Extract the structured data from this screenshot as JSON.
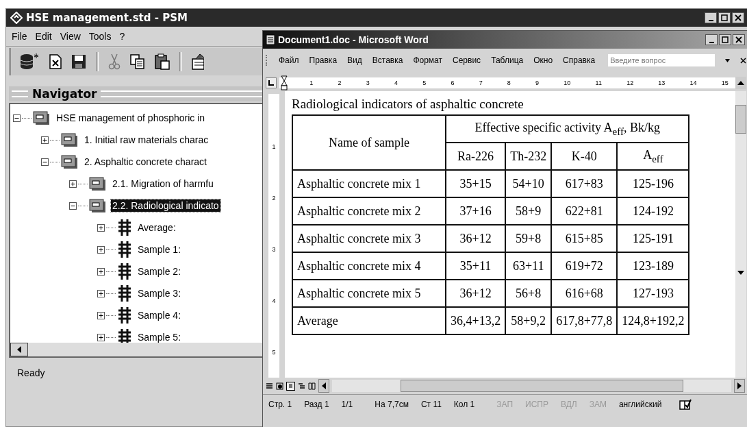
{
  "psm": {
    "title": "HSE management.std - PSM",
    "menu": [
      "File",
      "Edit",
      "View",
      "Tools",
      "?"
    ],
    "toolbar": [
      {
        "kind": "database"
      },
      {
        "kind": "close"
      },
      {
        "kind": "save"
      },
      {
        "kind": "cut"
      },
      {
        "kind": "copy"
      },
      {
        "kind": "paste"
      },
      {
        "kind": "properties"
      }
    ],
    "navigator": {
      "title": "Navigator",
      "tree": [
        {
          "label": "HSE management of phosphoric in",
          "kind": "folder",
          "expanded": true,
          "selected": false,
          "children": [
            {
              "label": "1. Initial raw materials charac",
              "kind": "folder",
              "expanded": false,
              "selected": false
            },
            {
              "label": "2. Asphaltic concrete charact",
              "kind": "folder",
              "expanded": true,
              "selected": false,
              "children": [
                {
                  "label": "2.1. Migration of harmfu",
                  "kind": "folder",
                  "expanded": false,
                  "selected": false
                },
                {
                  "label": "2.2. Radiological indicato",
                  "kind": "folder",
                  "expanded": true,
                  "selected": true,
                  "children": [
                    {
                      "label": "Average:",
                      "kind": "record",
                      "expanded": false,
                      "selected": false
                    },
                    {
                      "label": "Sample 1:",
                      "kind": "record",
                      "expanded": false,
                      "selected": false
                    },
                    {
                      "label": "Sample 2:",
                      "kind": "record",
                      "expanded": false,
                      "selected": false
                    },
                    {
                      "label": "Sample 3:",
                      "kind": "record",
                      "expanded": false,
                      "selected": false
                    },
                    {
                      "label": "Sample 4:",
                      "kind": "record",
                      "expanded": false,
                      "selected": false
                    },
                    {
                      "label": "Sample 5:",
                      "kind": "record",
                      "expanded": false,
                      "selected": false
                    }
                  ]
                }
              ]
            }
          ]
        }
      ]
    },
    "status_bar": "Ready"
  },
  "word": {
    "title": "Document1.doc - Microsoft Word",
    "menu": [
      "Файл",
      "Правка",
      "Вид",
      "Вставка",
      "Формат",
      "Сервис",
      "Таблица",
      "Окно",
      "Справка"
    ],
    "help_search": {
      "placeholder": "Введите вопрос"
    },
    "ruler": [
      "1",
      "2",
      "3",
      "4",
      "5",
      "6",
      "7",
      "8",
      "9",
      "10",
      "11",
      "12",
      "13",
      "14",
      "15"
    ],
    "vruler": [
      "1",
      "2",
      "3",
      "4",
      "5"
    ],
    "document": {
      "heading": "Radiological indicators of asphaltic concrete",
      "table": {
        "group_header": "Effective specific activity A$_{eff}$, Bk/kg",
        "columns": [
          "Name of sample",
          "Ra-226",
          "Th-232",
          "K-40",
          "A$_{eff}$"
        ],
        "rows": [
          [
            "Asphaltic concrete mix 1",
            "35+15",
            "54+10",
            "617+83",
            "125-196"
          ],
          [
            "Asphaltic concrete mix 2",
            "37+16",
            "58+9",
            "622+81",
            "124-192"
          ],
          [
            "Asphaltic concrete mix 3",
            "36+12",
            "59+8",
            "615+85",
            "125-191"
          ],
          [
            "Asphaltic concrete mix 4",
            "35+11",
            "63+11",
            "619+72",
            "123-189"
          ],
          [
            "Asphaltic concrete mix 5",
            "36+12",
            "56+8",
            "616+68",
            "127-193"
          ],
          [
            "Average",
            "36,4+13,2",
            "58+9,2",
            "617,8+77,8",
            "124,8+192,2"
          ]
        ]
      }
    },
    "status_bar": [
      {
        "text": "Стр. 1",
        "disabled": false
      },
      {
        "text": "Разд 1",
        "disabled": false
      },
      {
        "text": "1/1",
        "disabled": false
      },
      {
        "text": "На 7,7см",
        "disabled": false
      },
      {
        "text": "Ст 11",
        "disabled": false
      },
      {
        "text": "Кол 1",
        "disabled": false
      },
      {
        "text": "ЗАП",
        "disabled": true
      },
      {
        "text": "ИСПР",
        "disabled": true
      },
      {
        "text": "ВДЛ",
        "disabled": true
      },
      {
        "text": "ЗАМ",
        "disabled": true
      },
      {
        "text": "английский",
        "disabled": false
      }
    ]
  }
}
